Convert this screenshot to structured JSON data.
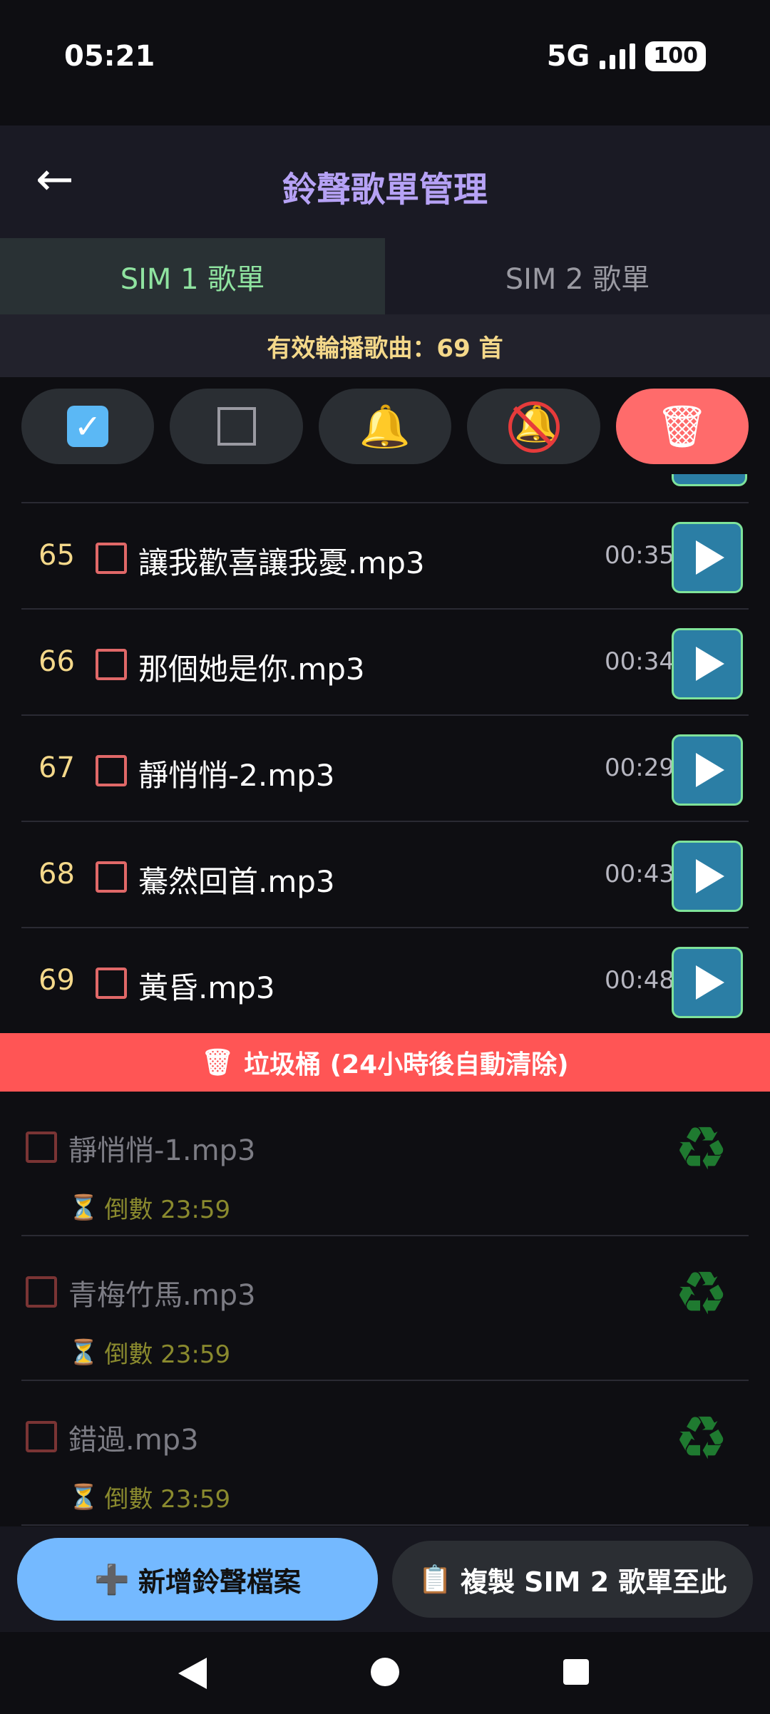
{
  "status": {
    "time": "05:21",
    "network": "5G",
    "battery": "100"
  },
  "appbar": {
    "back_glyph": "←",
    "title": "鈴聲歌單管理"
  },
  "tabs": [
    {
      "label": "SIM 1 歌單",
      "active": true
    },
    {
      "label": "SIM 2 歌單",
      "active": false
    }
  ],
  "count_text": "有效輪播歌曲：69 首",
  "toolbar": {
    "buttons": [
      {
        "icon": "checked-checkbox-icon"
      },
      {
        "icon": "empty-checkbox-icon"
      },
      {
        "icon": "bell-icon"
      },
      {
        "icon": "muted-bell-icon"
      },
      {
        "icon": "trash-icon"
      }
    ],
    "check_glyph": "✓",
    "bell_glyph": "🔔",
    "trash_glyph": "🗑"
  },
  "songs": [
    {
      "num": "65",
      "name": "讓我歡喜讓我憂.mp3",
      "duration": "00:35"
    },
    {
      "num": "66",
      "name": "那個她是你.mp3",
      "duration": "00:34"
    },
    {
      "num": "67",
      "name": "靜悄悄-2.mp3",
      "duration": "00:29"
    },
    {
      "num": "68",
      "name": "驀然回首.mp3",
      "duration": "00:43"
    },
    {
      "num": "69",
      "name": "黃昏.mp3",
      "duration": "00:48"
    }
  ],
  "trash": {
    "icon_glyph": "🗑",
    "title": "垃圾桶 (24小時後自動清除)",
    "hourglass_glyph": "⏳",
    "recycle_glyph": "♻",
    "items": [
      {
        "name": "靜悄悄-1.mp3",
        "countdown": "倒數 23:59"
      },
      {
        "name": "青梅竹馬.mp3",
        "countdown": "倒數 23:59"
      },
      {
        "name": "錯過.mp3",
        "countdown": "倒數 23:59"
      }
    ]
  },
  "bottom": {
    "add_glyph": "➕",
    "add_label": "新增鈴聲檔案",
    "copy_glyph": "📋",
    "copy_label": "複製 SIM 2 歌單至此"
  },
  "colors": {
    "accent_purple": "#b6a2f5",
    "accent_green": "#8fe3a0",
    "trash_red": "#ff5555",
    "add_blue": "#74b9ff",
    "number_yellow": "#f4d88a"
  }
}
